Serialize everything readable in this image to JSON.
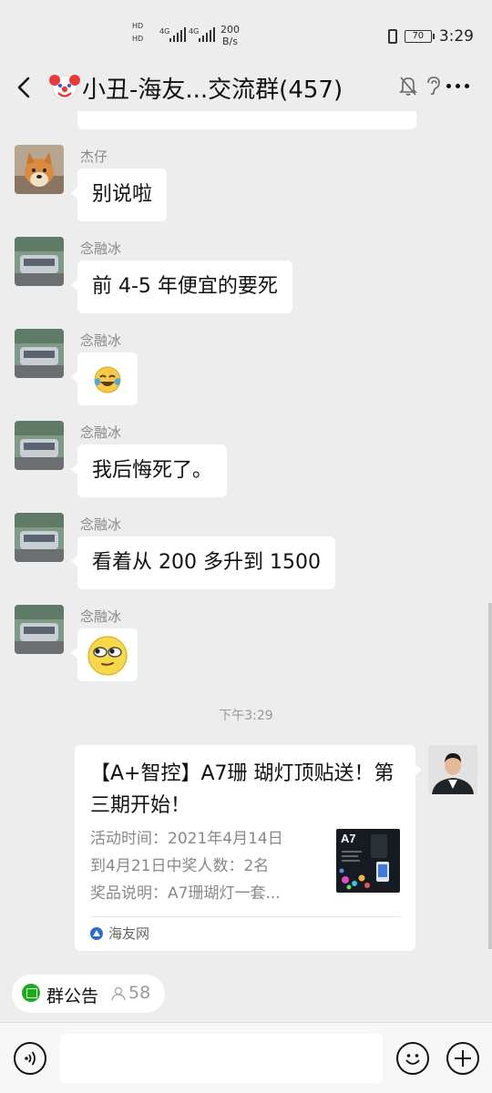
{
  "status_bar": {
    "hd1": "HD",
    "hd2": "HD",
    "net1": "4G",
    "net2": "4G",
    "speed_value": "200",
    "speed_unit": "B/s",
    "battery": "70",
    "time": "3:29"
  },
  "header": {
    "title": "小丑-海友...交流群(457)"
  },
  "messages": [
    {
      "sender": "杰仔",
      "text": "别说啦"
    },
    {
      "sender": "念融冰",
      "text": "前 4-5 年便宜的要死"
    },
    {
      "sender": "念融冰",
      "emoji": "laughing-crying-emoji"
    },
    {
      "sender": "念融冰",
      "text": "我后悔死了。"
    },
    {
      "sender": "念融冰",
      "text": "看着从 200 多升到 1500"
    },
    {
      "sender": "念融冰",
      "emoji": "rolling-eyes-emoji"
    }
  ],
  "timestamp": "下午3:29",
  "link_card": {
    "title": "【A+智控】A7珊 瑚灯顶贴送！第三期开始！",
    "desc_line1": "活动时间：2021年4月14日",
    "desc_line2": "到4月21日中奖人数：2名",
    "desc_line3": "奖品说明：A7珊瑚灯一套...",
    "thumb_label": "A7",
    "source": "海友网"
  },
  "notice": {
    "label": "群公告",
    "count": "58"
  },
  "colors": {
    "background": "#ededed",
    "bubble": "#ffffff",
    "notice_green": "#1aad19",
    "meta_gray": "#888888"
  }
}
